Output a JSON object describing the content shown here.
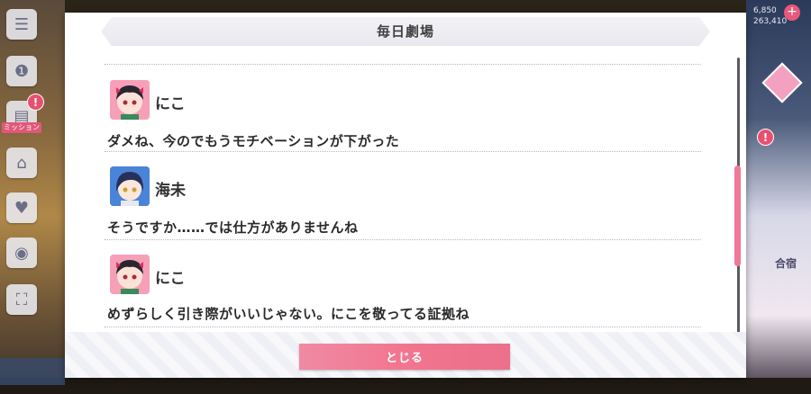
{
  "dialog": {
    "title": "毎日劇場",
    "entries": [
      {
        "speaker": "にこ",
        "line": "ダメね、今のでもうモチベーションが下がった",
        "avatar_color": "#f6a0b8"
      },
      {
        "speaker": "海未",
        "line": "そうですか……では仕方がありませんね",
        "avatar_color": "#4a84d8"
      },
      {
        "speaker": "にこ",
        "line": "めずらしく引き際がいいじゃない。にこを敬ってる証拠ね",
        "avatar_color": "#f6a0b8"
      }
    ],
    "close_label": "とじる"
  },
  "background": {
    "top_right_values": [
      "6,850",
      "263,410"
    ],
    "left_label": "ミッション",
    "right_label": "合宿"
  },
  "colors": {
    "accent_pink": "#f2758f",
    "scroll_thumb": "#f07898",
    "badge": "#e85070"
  }
}
